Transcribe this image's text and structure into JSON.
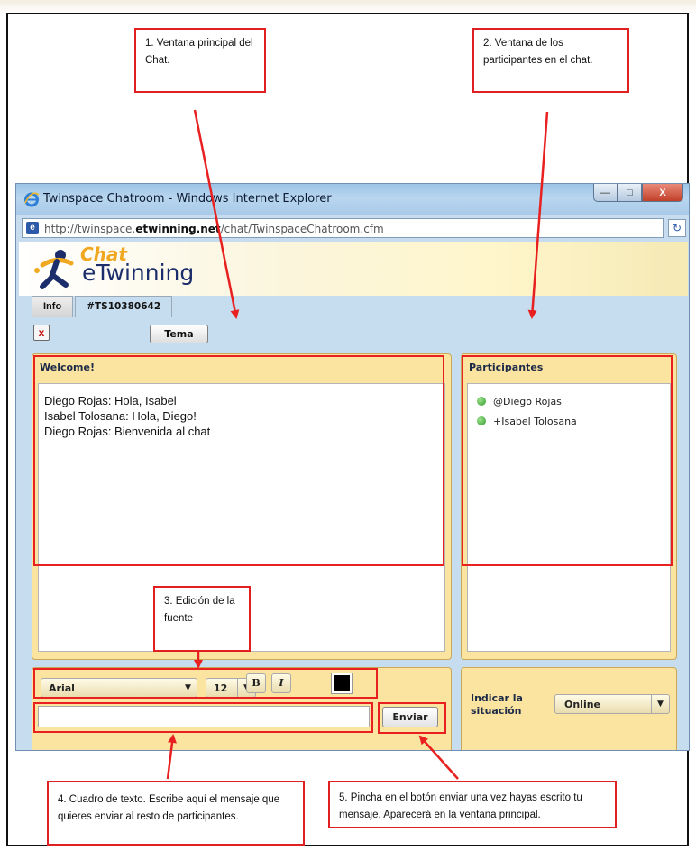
{
  "window": {
    "title": "Twinspace Chatroom - Windows Internet Explorer",
    "url_prefix": "http://twinspace.",
    "url_domain": "etwinning.net",
    "url_suffix": "/chat/TwinspaceChatroom.cfm"
  },
  "app": {
    "logo_chat": "Chat",
    "logo_etwinning": "eTwinning",
    "tabs": [
      {
        "label": "Info",
        "active": false
      },
      {
        "label": "#TS10380642",
        "active": true
      }
    ],
    "close_label": "x",
    "tema_label": "Tema"
  },
  "chat": {
    "title": "Welcome!",
    "messages": [
      "Diego Rojas: Hola, Isabel",
      "Isabel Tolosana: Hola, Diego!",
      "Diego Rojas: Bienvenida al chat"
    ]
  },
  "participants": {
    "title": "Participantes",
    "list": [
      "@Diego Rojas",
      "+Isabel Tolosana"
    ]
  },
  "font_controls": {
    "font_family": "Arial",
    "font_size": "12",
    "bold_label": "B",
    "italic_label": "I",
    "color": "#000000"
  },
  "composer": {
    "message_value": "",
    "send_label": "Enviar"
  },
  "status": {
    "label_line1": "Indicar la",
    "label_line2": "situación",
    "selected": "Online"
  },
  "callouts": {
    "c1": "1. Ventana principal del Chat.",
    "c2": "2. Ventana de  los participantes en el chat.",
    "c3": "3. Edición de la fuente",
    "c4": "4. Cuadro de texto. Escribe aquí el mensaje que quieres enviar al resto de participantes.",
    "c5": "5. Pincha en el botón enviar una vez hayas escrito tu mensaje. Aparecerá en la ventana principal."
  },
  "colors": {
    "annotation_red": "#e82020",
    "panel_yellow": "#fbe3a0",
    "page_blue": "#c6dcef"
  }
}
